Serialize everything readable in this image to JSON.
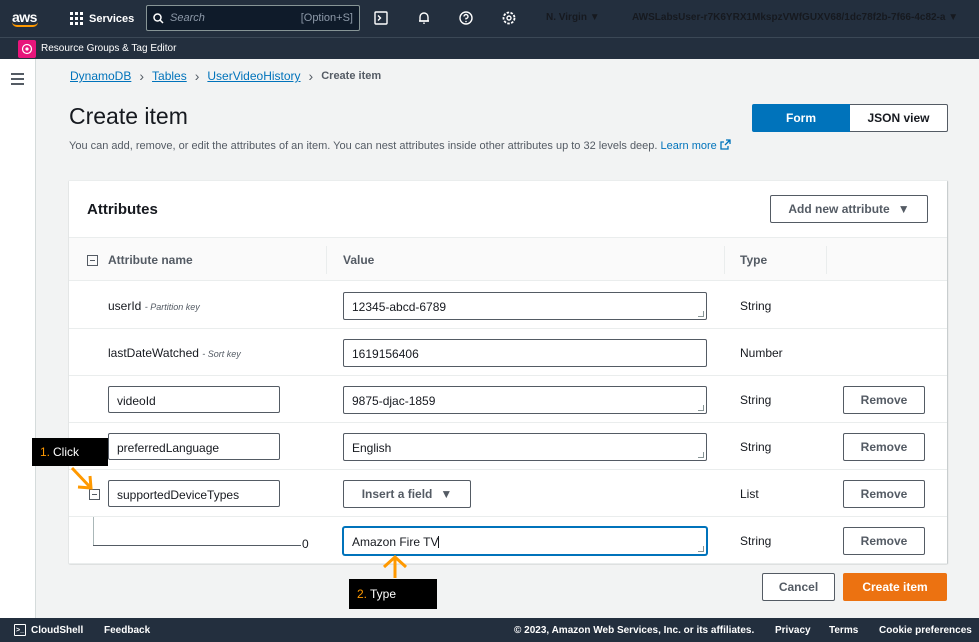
{
  "topnav": {
    "logo": "aws",
    "services_label": "Services",
    "search_placeholder": "Search",
    "search_shortcut": "[Option+S]",
    "region": "N. Virgin ▼",
    "user": "AWSLabsUser-r7K6YRX1MkspzVWfGUXV68/1dc78f2b-7f66-4c82-a ▼"
  },
  "favbar": {
    "item": "Resource Groups & Tag Editor"
  },
  "breadcrumb": {
    "items": [
      "DynamoDB",
      "Tables",
      "UserVideoHistory"
    ],
    "current": "Create item"
  },
  "header": {
    "title": "Create item",
    "description": "You can add, remove, or edit the attributes of an item. You can nest attributes inside other attributes up to 32 levels deep.",
    "learn_more": "Learn more",
    "view_form": "Form",
    "view_json": "JSON view"
  },
  "attributes": {
    "title": "Attributes",
    "add_button": "Add new attribute",
    "columns": [
      "Attribute name",
      "Value",
      "Type"
    ],
    "rows": [
      {
        "name": "userId",
        "key_label": "- Partition key",
        "value": "12345-abcd-6789",
        "type": "String"
      },
      {
        "name": "lastDateWatched",
        "key_label": "- Sort key",
        "value": "1619156406",
        "type": "Number"
      },
      {
        "name": "videoId",
        "value": "9875-djac-1859",
        "type": "String",
        "remove": "Remove"
      },
      {
        "name": "preferredLanguage",
        "value": "English",
        "type": "String",
        "remove": "Remove"
      },
      {
        "name": "supportedDeviceTypes",
        "insert_label": "Insert a field",
        "type": "List",
        "remove": "Remove"
      },
      {
        "index": "0",
        "value": "Amazon Fire TV",
        "type": "String",
        "remove": "Remove"
      }
    ]
  },
  "actions": {
    "cancel": "Cancel",
    "create": "Create item"
  },
  "annotations": {
    "step1_num": "1.",
    "step1_text": "Click",
    "step2_num": "2.",
    "step2_text": "Type",
    "accent": "#ff9900"
  },
  "footer": {
    "cloudshell": "CloudShell",
    "feedback": "Feedback",
    "copyright": "© 2023, Amazon Web Services, Inc. or its affiliates.",
    "privacy": "Privacy",
    "terms": "Terms",
    "cookies": "Cookie preferences"
  },
  "colors": {
    "nav_bg": "#232f3e",
    "primary": "#0073bb",
    "create": "#ec7211"
  }
}
